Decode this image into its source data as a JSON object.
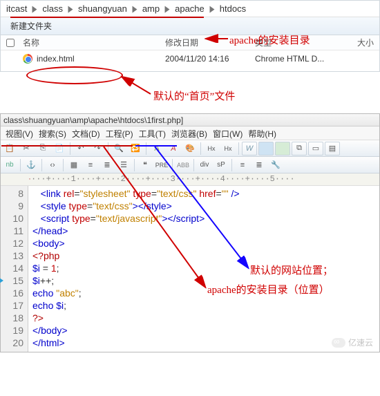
{
  "explorer": {
    "breadcrumb": [
      "itcast",
      "class",
      "shuangyuan",
      "amp",
      "apache",
      "htdocs"
    ],
    "toolbar": {
      "new_folder": "新建文件夹"
    },
    "headers": {
      "name": "名称",
      "date": "修改日期",
      "type": "类型",
      "size": "大小"
    },
    "file": {
      "name": "index.html",
      "date": "2004/11/20 14:16",
      "type": "Chrome HTML D..."
    }
  },
  "annotations": {
    "a1": "apache的安装目录",
    "a2": "默认的“首页”文件",
    "a3": "默认的网站位置；",
    "a4": "apache的安装目录（位置）"
  },
  "editor": {
    "title_path": "class\\shuangyuan\\amp\\apache\\htdocs\\1first.php]",
    "menus": [
      "视图(V)",
      "搜索(S)",
      "文档(D)",
      "工程(P)",
      "工具(T)",
      "浏览器(B)",
      "窗口(W)",
      "帮助(H)"
    ],
    "toolbar_icons_row1": [
      "paste",
      "scissors",
      "copy",
      "clipboard",
      "undo",
      "redo",
      "sep",
      "search",
      "replace",
      "sep",
      "font-dec",
      "font-inc",
      "color",
      "sep",
      "hx",
      "hx2",
      "sep",
      "wb",
      "blue",
      "green",
      "copy2",
      "box",
      "box2"
    ],
    "toolbar_icons_row2": [
      "nb",
      "sep",
      "ang",
      "sep",
      "lt",
      "sep",
      "layers",
      "align-l",
      "align-c",
      "align-r",
      "sep",
      "quote",
      "pre",
      "sep",
      "abbr",
      "sep",
      "div",
      "sp",
      "sep",
      "bars",
      "bars2",
      "sep"
    ],
    "ruler_text": "····|····1····|····2····|····3····|····4····|····5····",
    "lines": [
      {
        "n": 8,
        "html": "   <link rel=\"stylesheet\" type=\"text/css\" href=\"\" />"
      },
      {
        "n": 9,
        "html": "   <style type=\"text/css\"></style>"
      },
      {
        "n": 10,
        "html": "   <script type=\"text/javascript\"></script>"
      },
      {
        "n": 11,
        "html": "</head>"
      },
      {
        "n": 12,
        "html": "<body>"
      },
      {
        "n": 13,
        "html": "<?php"
      },
      {
        "n": 14,
        "html": "$i = 1;"
      },
      {
        "n": 15,
        "html": "$i++;"
      },
      {
        "n": 16,
        "html": "echo \"abc\";"
      },
      {
        "n": 17,
        "html": "echo $i;"
      },
      {
        "n": 18,
        "html": "?>"
      },
      {
        "n": 19,
        "html": "</body>"
      },
      {
        "n": 20,
        "html": "</html>"
      }
    ]
  },
  "watermark": "亿速云"
}
